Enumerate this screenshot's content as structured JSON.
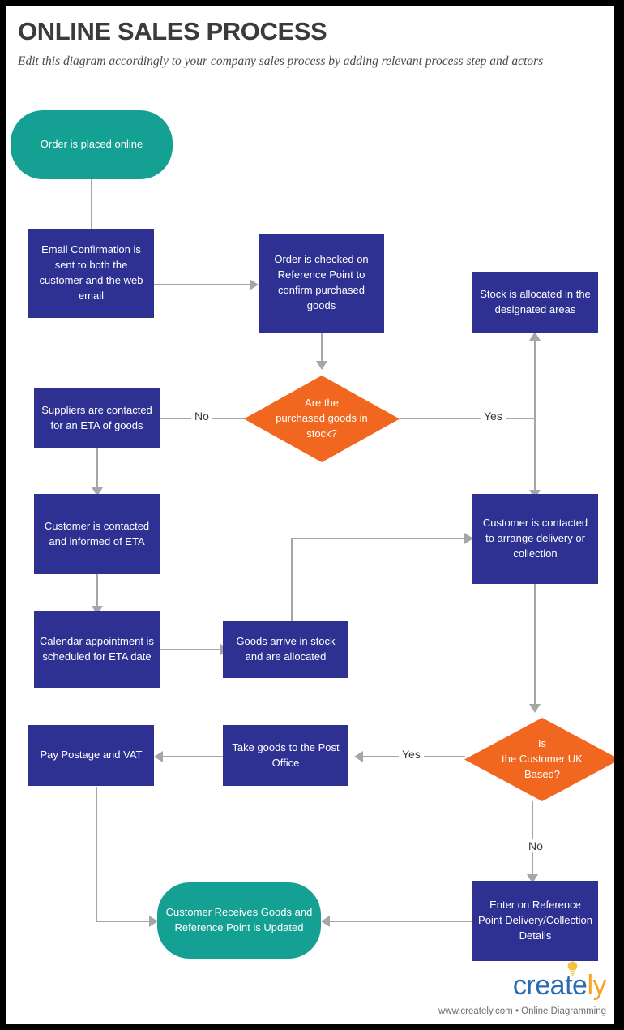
{
  "header": {
    "title": "ONLINE SALES PROCESS",
    "subtitle": "Edit this diagram accordingly to your company sales process by adding relevant process step and actors"
  },
  "colors": {
    "process": "#2E3192",
    "terminator": "#14A193",
    "decision": "#F2671F",
    "connector": "#A6A6A6",
    "page": "#ffffff",
    "frame": "#000000",
    "logo_blue": "#2B6CB5",
    "logo_orange": "#F5A623"
  },
  "chart_data": {
    "type": "diagram",
    "diagram_kind": "flowchart",
    "title": "ONLINE SALES PROCESS",
    "nodes": [
      {
        "id": "start",
        "shape": "terminator",
        "label": "Order is placed online"
      },
      {
        "id": "email",
        "shape": "process",
        "label": "Email Confirmation is sent to both the customer and the web email"
      },
      {
        "id": "check",
        "shape": "process",
        "label": "Order is checked on Reference Point to confirm purchased goods"
      },
      {
        "id": "instock",
        "shape": "decision",
        "label": "Are the\npurchased goods  in\nstock?"
      },
      {
        "id": "suppliers",
        "shape": "process",
        "label": "Suppliers are contacted for an ETA of goods"
      },
      {
        "id": "stockalloc",
        "shape": "process",
        "label": "Stock is allocated in the designated areas"
      },
      {
        "id": "custeta",
        "shape": "process",
        "label": "Customer is contacted and informed of ETA"
      },
      {
        "id": "delivery",
        "shape": "process",
        "label": "Customer is contacted to arrange delivery or collection"
      },
      {
        "id": "calendar",
        "shape": "process",
        "label": "Calendar appointment is scheduled for ETA date"
      },
      {
        "id": "goodsarrive",
        "shape": "process",
        "label": "Goods arrive in stock and are allocated"
      },
      {
        "id": "ukbased",
        "shape": "decision",
        "label": "Is\nthe Customer  UK\nBased?"
      },
      {
        "id": "postoffice",
        "shape": "process",
        "label": "Take goods to the Post Office"
      },
      {
        "id": "postage",
        "shape": "process",
        "label": "Pay Postage and VAT"
      },
      {
        "id": "enterref",
        "shape": "process",
        "label": "Enter on Reference Point Delivery/Collection Details"
      },
      {
        "id": "end",
        "shape": "terminator",
        "label": "Customer Receives Goods and Reference Point is Updated"
      }
    ],
    "edges": [
      {
        "from": "start",
        "to": "email",
        "label": ""
      },
      {
        "from": "email",
        "to": "check",
        "label": ""
      },
      {
        "from": "check",
        "to": "instock",
        "label": ""
      },
      {
        "from": "instock",
        "to": "suppliers",
        "label": "No"
      },
      {
        "from": "instock",
        "to": "stockalloc",
        "label": "Yes"
      },
      {
        "from": "suppliers",
        "to": "custeta",
        "label": ""
      },
      {
        "from": "stockalloc",
        "to": "delivery",
        "label": ""
      },
      {
        "from": "custeta",
        "to": "calendar",
        "label": ""
      },
      {
        "from": "calendar",
        "to": "goodsarrive",
        "label": ""
      },
      {
        "from": "goodsarrive",
        "to": "delivery",
        "label": ""
      },
      {
        "from": "delivery",
        "to": "ukbased",
        "label": ""
      },
      {
        "from": "ukbased",
        "to": "postoffice",
        "label": "Yes"
      },
      {
        "from": "ukbased",
        "to": "enterref",
        "label": "No"
      },
      {
        "from": "postoffice",
        "to": "postage",
        "label": ""
      },
      {
        "from": "postage",
        "to": "end",
        "label": ""
      },
      {
        "from": "enterref",
        "to": "end",
        "label": ""
      }
    ],
    "edge_labels": [
      "No",
      "Yes",
      "Yes",
      "No"
    ]
  },
  "nodes": {
    "start": "Order is placed online",
    "email": "Email Confirmation is sent to both the customer and the web email",
    "check": "Order is checked on Reference Point to confirm purchased goods",
    "instock": "Are the\npurchased goods  in\nstock?",
    "suppliers": "Suppliers are contacted for an ETA of goods",
    "stockalloc": "Stock is allocated in the designated areas",
    "custeta": "Customer is contacted and informed of ETA",
    "delivery": "Customer is contacted to arrange delivery or collection",
    "calendar": "Calendar appointment is scheduled for ETA date",
    "goodsarrive": "Goods arrive in stock and are allocated",
    "ukbased": "Is\nthe Customer  UK\nBased?",
    "postoffice": "Take goods to the Post Office",
    "postage": "Pay Postage and VAT",
    "enterref": "Enter on Reference Point Delivery/Collection Details",
    "end": "Customer Receives Goods and Reference Point is Updated"
  },
  "labels": {
    "no_stock": "No",
    "yes_stock": "Yes",
    "yes_uk": "Yes",
    "no_uk": "No"
  },
  "footer": {
    "logo_part1": "creat",
    "logo_part2": "e",
    "logo_part3": "ly",
    "tagline": "www.creately.com • Online Diagramming"
  }
}
